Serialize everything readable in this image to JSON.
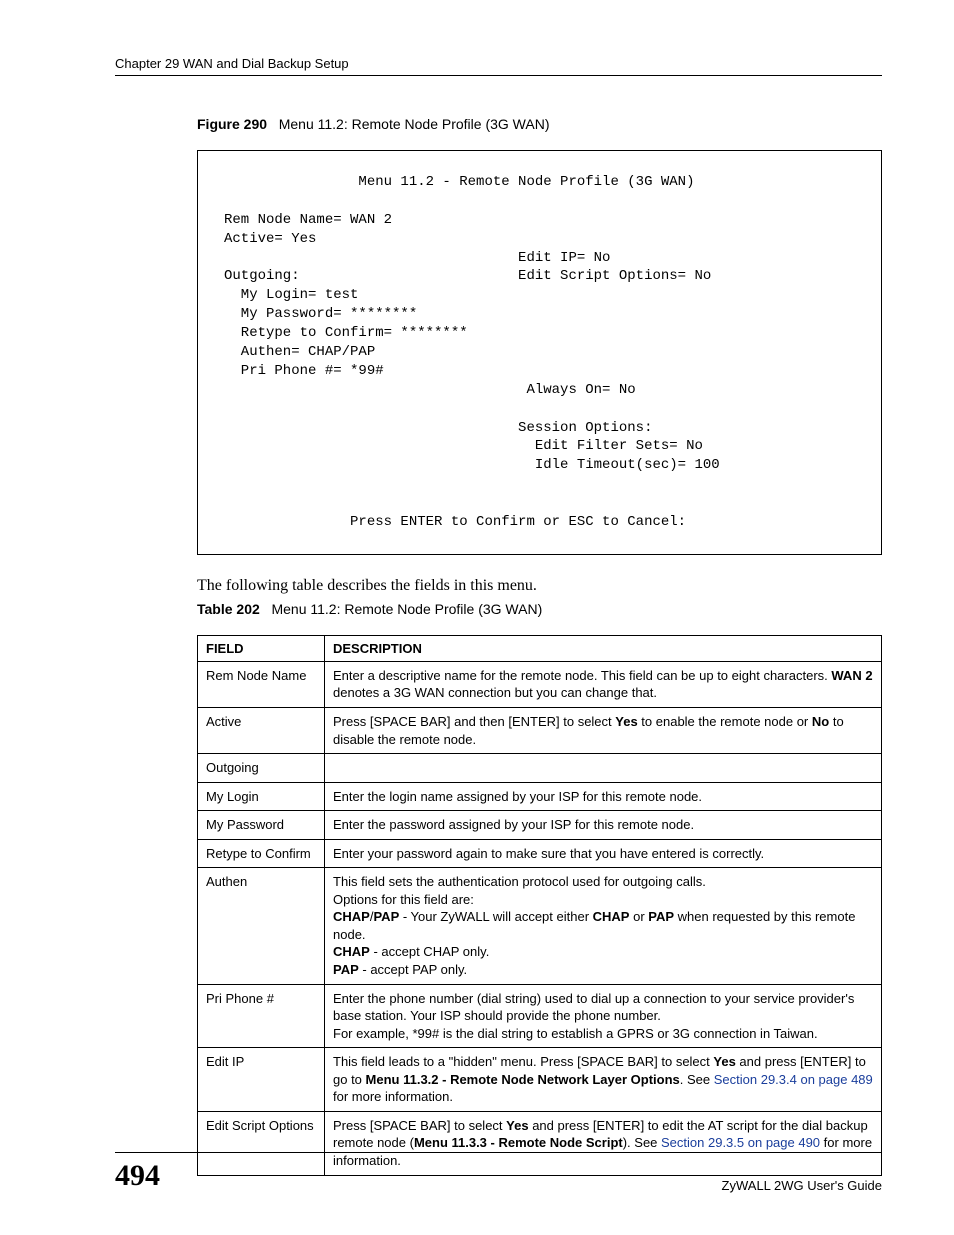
{
  "header": {
    "running_head": "Chapter 29 WAN and Dial Backup Setup"
  },
  "figure": {
    "label": "Figure 290",
    "title": "Menu 11.2: Remote Node Profile (3G WAN)",
    "terminal": "                Menu 11.2 - Remote Node Profile (3G WAN)\n\nRem Node Name= WAN 2\nActive= Yes\n                                   Edit IP= No\nOutgoing:                          Edit Script Options= No\n  My Login= test\n  My Password= ********\n  Retype to Confirm= ********\n  Authen= CHAP/PAP\n  Pri Phone #= *99#\n                                    Always On= No\n\n                                   Session Options:\n                                     Edit Filter Sets= No\n                                     Idle Timeout(sec)= 100\n\n\n               Press ENTER to Confirm or ESC to Cancel:"
  },
  "intro": "The following table describes the fields in this menu.",
  "table": {
    "label": "Table 202",
    "title": "Menu 11.2: Remote Node Profile (3G WAN)",
    "col_field": "FIELD",
    "col_desc": "DESCRIPTION",
    "rows": [
      {
        "field": "Rem Node Name",
        "desc": "Enter a descriptive name for the remote node. This field can be up to eight characters. <b>WAN 2</b> denotes a 3G WAN connection but you can change that."
      },
      {
        "field": "Active",
        "desc": "Press [SPACE BAR] and then [ENTER] to select <b>Yes</b> to enable the remote node or <b>No</b> to disable the remote node."
      },
      {
        "field": "Outgoing",
        "desc": ""
      },
      {
        "field": "My Login",
        "desc": "Enter the login name assigned by your ISP for this remote node."
      },
      {
        "field": "My Password",
        "desc": "Enter the password assigned by your ISP for this remote node."
      },
      {
        "field": "Retype to Confirm",
        "desc": "Enter your password again to make sure that you have entered is correctly."
      },
      {
        "field": "Authen",
        "desc": "This field sets the authentication protocol used for outgoing calls.<br>Options for this field are:<br><b>CHAP</b>/<b>PAP</b> - Your ZyWALL will accept either <b>CHAP</b> or <b>PAP</b> when requested by this remote node.<br><b>CHAP</b> - accept CHAP only.<br><b>PAP</b> - accept PAP only."
      },
      {
        "field": "Pri Phone #",
        "desc": "Enter the phone number (dial string) used to dial up a connection to your service provider's base station. Your ISP should provide the phone number.<br>For example, *99# is the dial string to establish a GPRS or 3G connection in Taiwan."
      },
      {
        "field": "Edit IP",
        "desc": "This field leads to a \"hidden\" menu. Press [SPACE BAR] to select <b>Yes</b> and press [ENTER] to go to <b>Menu 11.3.2 - Remote Node Network Layer Options</b>. See <span class=\"link\">Section 29.3.4 on page 489</span> for more information."
      },
      {
        "field": "Edit Script Options",
        "desc": "Press [SPACE BAR] to select <b>Yes</b> and press [ENTER] to edit the AT script for the dial backup remote node (<b>Menu 11.3.3 - Remote Node Script</b>). See <span class=\"link\">Section 29.3.5 on page 490</span> for more information."
      }
    ]
  },
  "footer": {
    "page_number": "494",
    "guide": "ZyWALL 2WG User's Guide"
  }
}
